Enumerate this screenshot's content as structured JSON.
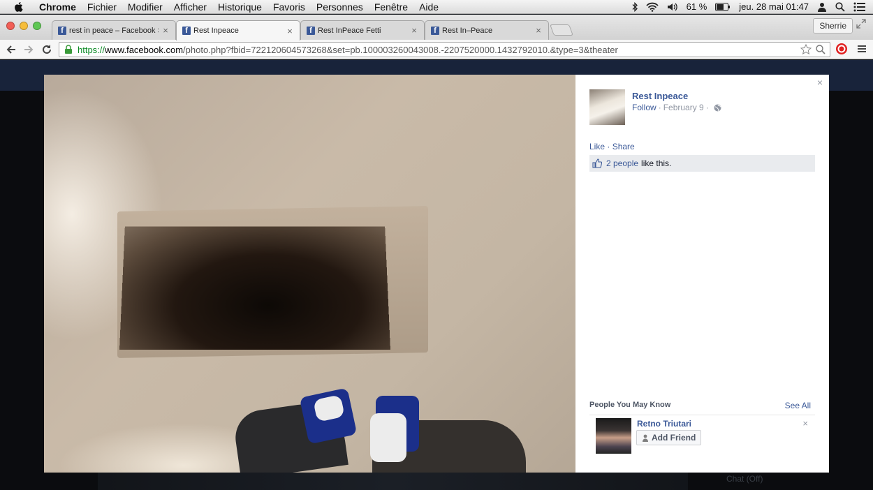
{
  "menubar": {
    "app": "Chrome",
    "items": [
      "Fichier",
      "Modifier",
      "Afficher",
      "Historique",
      "Favoris",
      "Personnes",
      "Fenêtre",
      "Aide"
    ],
    "battery": "61 %",
    "datetime": "jeu. 28 mai  01:47"
  },
  "tabs": [
    {
      "title": "rest in peace – Facebook S"
    },
    {
      "title": "Rest Inpeace"
    },
    {
      "title": "Rest InPeace Fetti"
    },
    {
      "title": "Rest In–Peace"
    }
  ],
  "profile": "Sherrie",
  "address": {
    "scheme": "https://",
    "host": "www.facebook.com",
    "path": "/photo.php?fbid=722120604573268&set=pb.100003260043008.-2207520000.1432792010.&type=3&theater"
  },
  "post": {
    "owner": "Rest Inpeace",
    "follow": "Follow",
    "separator": "·",
    "date": "February 9",
    "like": "Like",
    "share": "Share",
    "likes_link": "2 people",
    "likes_text": "like this."
  },
  "pymk": {
    "title": "People You May Know",
    "see_all": "See All",
    "person": "Retno Triutari",
    "add_friend": "Add Friend",
    "dismiss": "×"
  },
  "chat": "Chat (Off)",
  "close": "×"
}
